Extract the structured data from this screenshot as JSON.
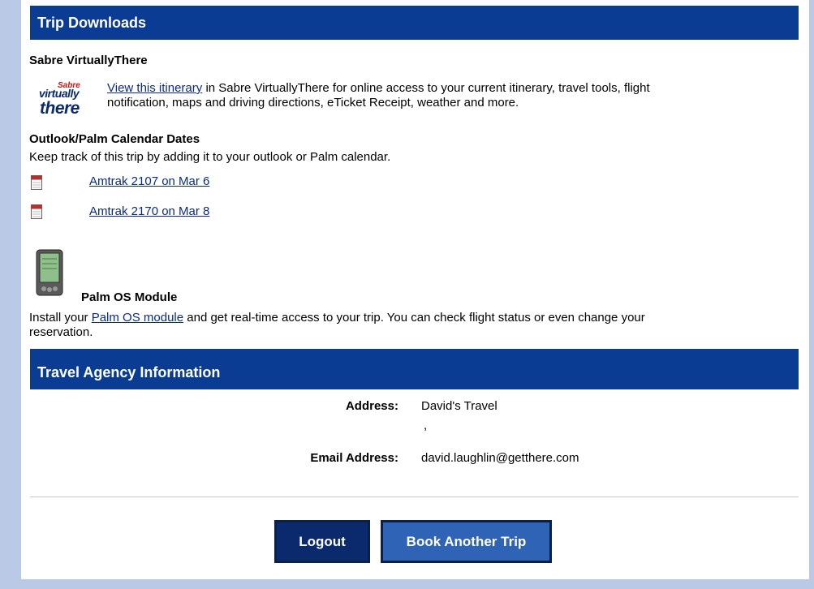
{
  "trip_downloads": {
    "title": "Trip Downloads",
    "virtuallythere_heading": "Sabre VirtuallyThere",
    "logo": {
      "line1": "Sabre",
      "line2": "virtually",
      "line3": "there"
    },
    "view_itinerary_link": "View this itinerary",
    "virtuallythere_text_1": " in Sabre VirtuallyThere for online access to your current itinerary, travel tools, flight",
    "virtuallythere_text_2": "notification, maps and driving directions, eTicket Receipt, weather and more.",
    "calendar_heading": "Outlook/Palm Calendar Dates",
    "calendar_text": "Keep track of this trip by adding it to your outlook or Palm calendar.",
    "calendar_links": [
      "Amtrak 2107 on Mar 6",
      "Amtrak 2170 on Mar 8"
    ],
    "palm_heading": "Palm OS Module",
    "palm_text_prefix": "Install your ",
    "palm_link": "Palm OS module",
    "palm_text_suffix": " and get real-time access to your trip. You can check flight status or even change your",
    "palm_text_line2": "reservation."
  },
  "agency": {
    "title": "Travel Agency Information",
    "address_label": "Address:",
    "address_value": "David's Travel",
    "address_line2": ",",
    "email_label": "Email Address:",
    "email_value": "david.laughlin@getthere.com"
  },
  "buttons": {
    "logout": "Logout",
    "book_another": "Book Another Trip"
  },
  "colors": {
    "header_bg": "#0b3c93",
    "page_bg": "#b9c9e6",
    "link": "#0a2a8a"
  }
}
